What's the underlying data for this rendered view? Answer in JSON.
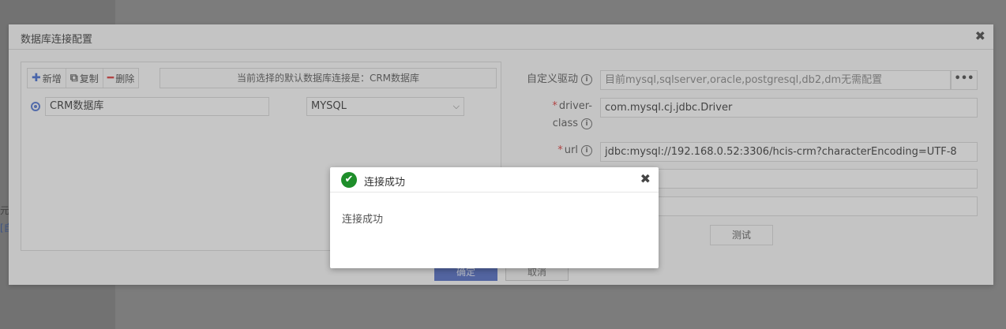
{
  "background": {
    "snippet1": "元主",
    "snippet2": "[自"
  },
  "dialog": {
    "title": "数据库连接配置",
    "close_glyph": "✖"
  },
  "toolbar": {
    "add_icon": "plus-icon",
    "add_label": "新增",
    "copy_icon": "copy-icon",
    "copy_label": "复制",
    "delete_icon": "minus-icon",
    "delete_label": "删除",
    "info": "当前选择的默认数据库连接是：CRM数据库"
  },
  "connections": [
    {
      "selected": true,
      "name": "CRM数据库",
      "type": "MYSQL"
    }
  ],
  "form": {
    "driver_label": "自定义驱动",
    "driver_placeholder": "目前mysql,sqlserver,oracle,postgresql,db2,dm无需配置",
    "driver_button": "•••",
    "driver_class_label_1": "driver-",
    "driver_class_label_2": "class",
    "driver_class_value": "com.mysql.cj.jdbc.Driver",
    "url_label": "url",
    "url_value": "jdbc:mysql://192.168.0.52:3306/hcis-crm?characterEncoding=UTF-8",
    "test_button": "测试"
  },
  "footer": {
    "ok_label": "确定",
    "cancel_label": "取消"
  },
  "message": {
    "title": "连接成功",
    "content": "连接成功",
    "close_glyph": "✖"
  },
  "colors": {
    "primary": "#3a57b8",
    "success": "#1e8e2a",
    "required": "#d42626"
  }
}
